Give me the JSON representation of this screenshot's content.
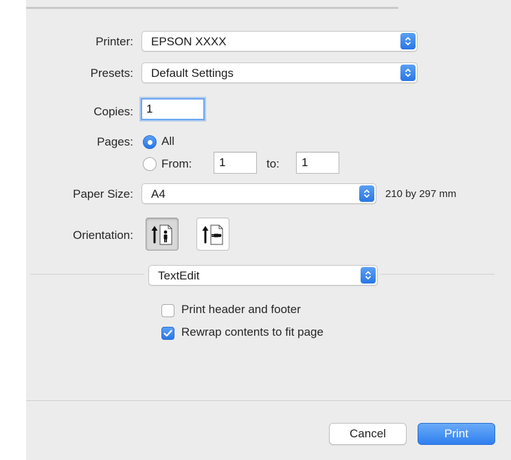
{
  "dialog": {
    "printer": {
      "label": "Printer:",
      "value": "EPSON XXXX"
    },
    "presets": {
      "label": "Presets:",
      "value": "Default Settings"
    },
    "copies": {
      "label": "Copies:",
      "value": "1"
    },
    "pages": {
      "label": "Pages:",
      "all_label": "All",
      "from_label": "From:",
      "from_value": "1",
      "to_label": "to:",
      "to_value": "1"
    },
    "paper_size": {
      "label": "Paper Size:",
      "value": "A4",
      "dimensions": "210 by 297 mm"
    },
    "orientation": {
      "label": "Orientation:",
      "selected": "portrait"
    },
    "section_popup": {
      "value": "TextEdit"
    },
    "options": {
      "print_header_footer": {
        "label": "Print header and footer",
        "checked": false
      },
      "rewrap_contents": {
        "label": "Rewrap contents to fit page",
        "checked": true
      }
    },
    "buttons": {
      "cancel": "Cancel",
      "print": "Print"
    }
  },
  "colors": {
    "accent": "#2f7ff0",
    "background": "#ececec"
  }
}
